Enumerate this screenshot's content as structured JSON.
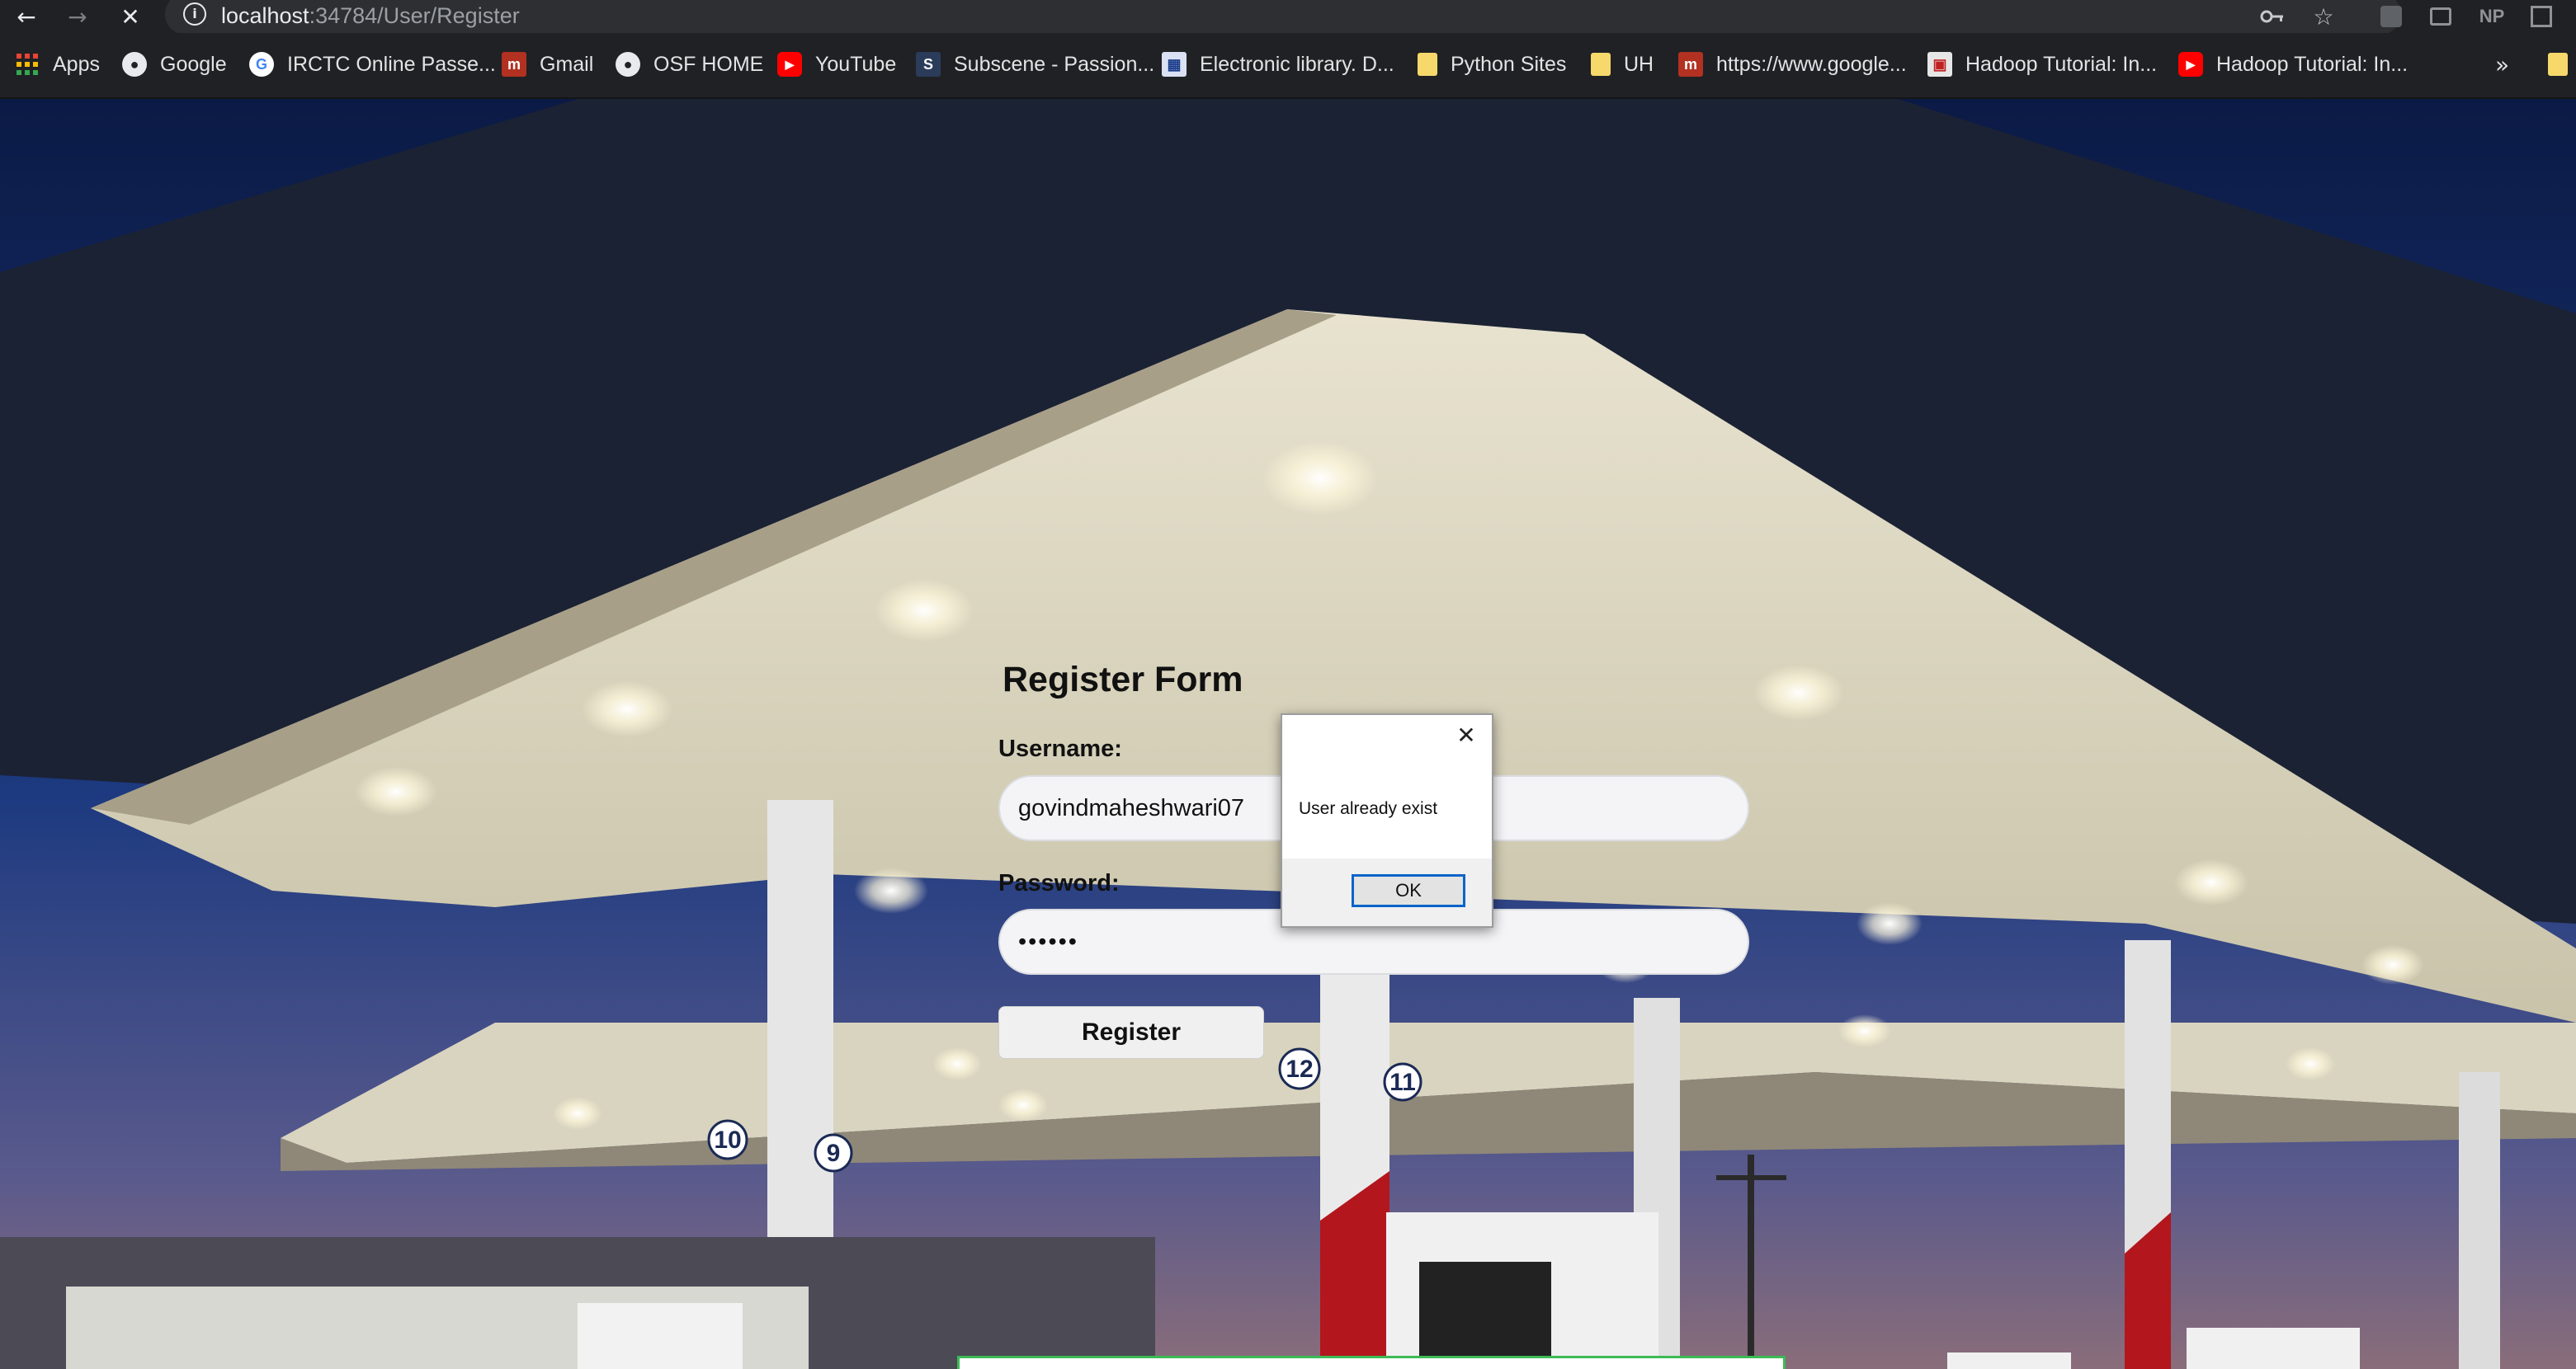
{
  "browser": {
    "url_host": "localhost",
    "url_path": ":34784/User/Register",
    "profile_initials": "NP"
  },
  "bookmarks": [
    {
      "label": "Apps",
      "icon": "apps-grid-icon"
    },
    {
      "label": "Google",
      "icon": "globe-icon"
    },
    {
      "label": "IRCTC Online Passe...",
      "icon": "google-icon"
    },
    {
      "label": "Gmail",
      "icon": "site-favicon-icon"
    },
    {
      "label": "OSF HOME",
      "icon": "globe-icon"
    },
    {
      "label": "YouTube",
      "icon": "youtube-icon"
    },
    {
      "label": "Subscene - Passion...",
      "icon": "subscene-icon"
    },
    {
      "label": "Electronic library. D...",
      "icon": "library-icon"
    },
    {
      "label": "Python Sites",
      "icon": "folder-icon"
    },
    {
      "label": "UH",
      "icon": "folder-icon"
    },
    {
      "label": "https://www.google...",
      "icon": "site-favicon-icon"
    },
    {
      "label": "Hadoop Tutorial: In...",
      "icon": "site-favicon-icon"
    },
    {
      "label": "Hadoop Tutorial: In...",
      "icon": "youtube-icon"
    }
  ],
  "form": {
    "title": "Register Form",
    "username_label": "Username:",
    "username_value": "govindmaheshwari07",
    "password_label": "Password:",
    "password_value": "••••••",
    "submit_label": "Register"
  },
  "alert": {
    "message": "User already exist",
    "ok_label": "OK"
  }
}
